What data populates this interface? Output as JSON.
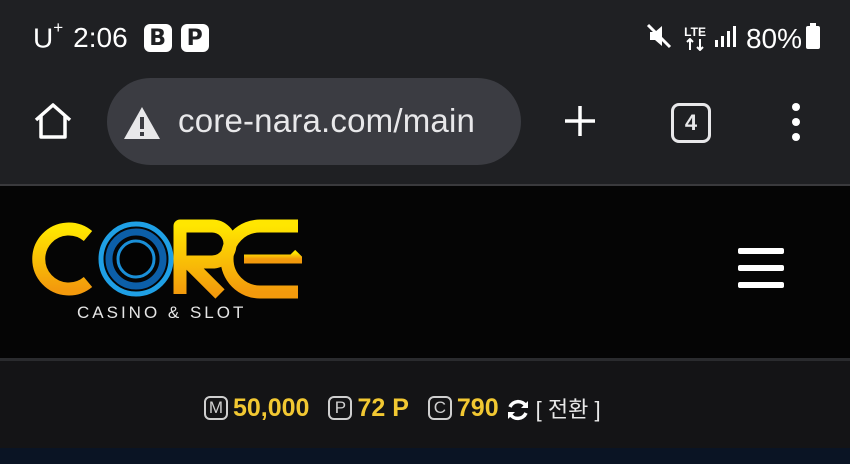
{
  "status_bar": {
    "carrier": "U",
    "carrier_sup": "+",
    "time": "2:06",
    "app_badges": [
      "B",
      "P"
    ],
    "network": "LTE",
    "battery": "80%"
  },
  "browser": {
    "url": "core-nara.com/main",
    "tab_count": "4"
  },
  "site": {
    "logo_text": "CORE",
    "logo_tagline": "CASINO & SLOT",
    "colors": {
      "accent_gold": "#f2c832",
      "logo_blue": "#1a8fd8"
    }
  },
  "balance": {
    "money_icon": "M",
    "money": "50,000",
    "point_icon": "P",
    "points": "72 P",
    "coin_icon": "C",
    "coins": "790",
    "switch_label": "[ 전환 ]"
  }
}
